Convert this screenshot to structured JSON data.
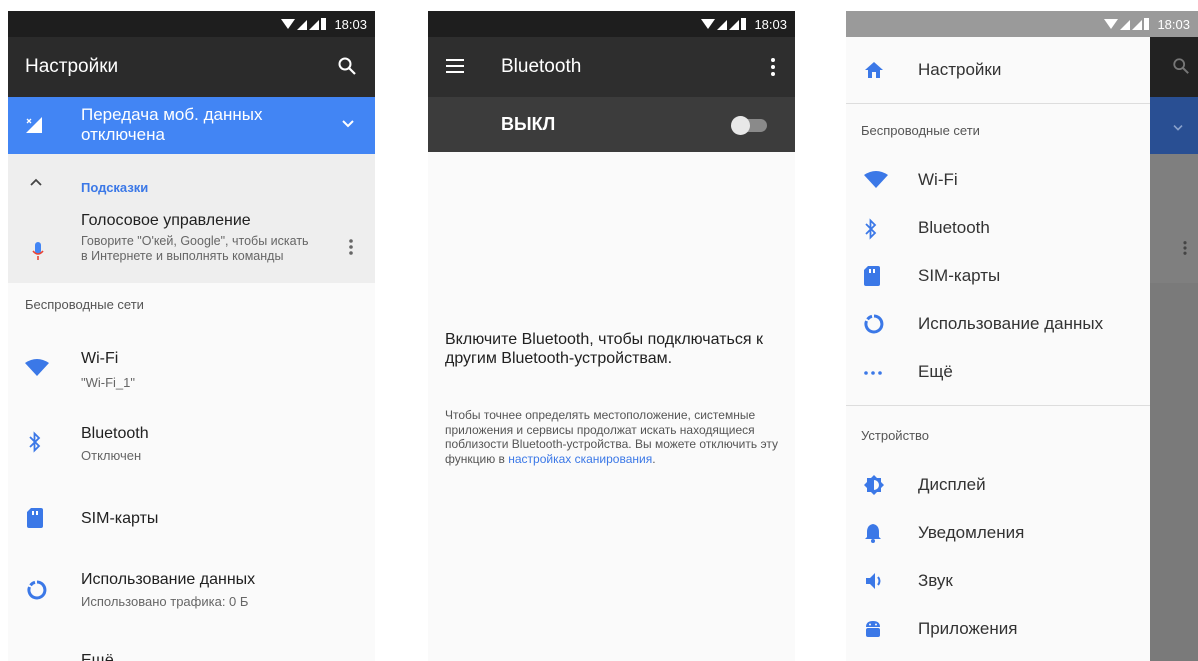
{
  "status": {
    "time": "18:03"
  },
  "screen1": {
    "title": "Настройки",
    "banner": "Передача моб. данных отключена",
    "hints_header": "Подсказки",
    "hint_title": "Голосовое управление",
    "hint_text": "Говорите \"О'кей, Google\", чтобы искать в Интернете и выполнять команды",
    "section": "Беспроводные сети",
    "items": [
      {
        "title": "Wi-Fi",
        "subtitle": "\"Wi-Fi_1\""
      },
      {
        "title": "Bluetooth",
        "subtitle": "Отключен"
      },
      {
        "title": "SIM-карты",
        "subtitle": ""
      },
      {
        "title": "Использование данных",
        "subtitle": "Использовано трафика: 0 Б"
      },
      {
        "title": "Ещё",
        "subtitle": ""
      }
    ]
  },
  "screen2": {
    "title": "Bluetooth",
    "toggle_label": "ВЫКЛ",
    "message": "Включите Bluetooth, чтобы подключаться к другим Bluetooth-устройствам.",
    "details": "Чтобы точнее определять местоположение, системные приложения и сервисы продолжат искать находящиеся поблизости Bluetooth-устройства. Вы можете отключить эту функцию в",
    "link": "настройках сканирования",
    "link_suffix": "."
  },
  "screen3": {
    "drawer_title": "Настройки",
    "section1": "Беспроводные сети",
    "section1_items": [
      "Wi-Fi",
      "Bluetooth",
      "SIM-карты",
      "Использование данных",
      "Ещё"
    ],
    "section2": "Устройство",
    "section2_items": [
      "Дисплей",
      "Уведомления",
      "Звук",
      "Приложения"
    ]
  },
  "colors": {
    "accent": "#4285f4",
    "appbar": "#2b2b2b"
  }
}
